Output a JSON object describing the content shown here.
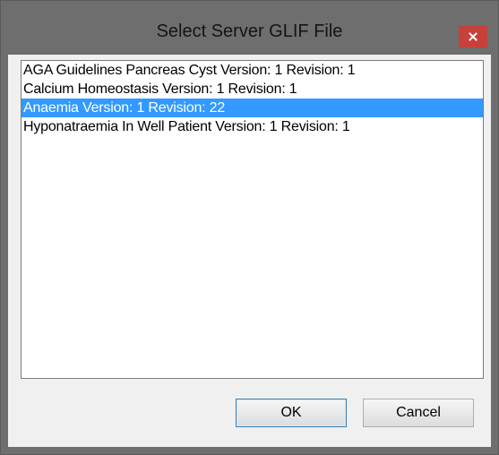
{
  "window": {
    "title": "Select Server GLIF File",
    "close_icon": "close-icon"
  },
  "list": {
    "items": [
      {
        "label": "AGA Guidelines Pancreas Cyst Version: 1 Revision: 1",
        "selected": false
      },
      {
        "label": "Calcium Homeostasis Version: 1 Revision: 1",
        "selected": false
      },
      {
        "label": "Anaemia Version: 1 Revision: 22",
        "selected": true
      },
      {
        "label": "Hyponatraemia In Well Patient Version: 1 Revision: 1",
        "selected": false
      }
    ]
  },
  "buttons": {
    "ok_label": "OK",
    "cancel_label": "Cancel"
  },
  "colors": {
    "selection": "#3399ff",
    "close_button": "#c7403a",
    "titlebar": "#6e6e6e"
  }
}
